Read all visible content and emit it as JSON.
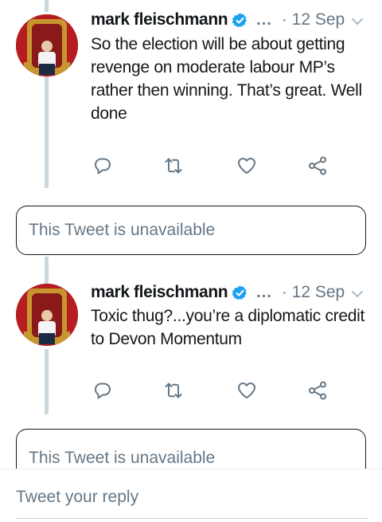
{
  "tweets": [
    {
      "author": "mark fleischmann",
      "more": "...",
      "date": "· 12 Sep",
      "text": "So the election will be about getting revenge on moderate labour MP’s rather then winning. That’s great. Well done"
    },
    {
      "author": "mark fleischmann",
      "more": "...",
      "date": "· 12 Sep",
      "text": "Toxic thug?...you’re a diplomatic credit to Devon Momentum"
    }
  ],
  "unavailable": [
    {
      "label": "This Tweet is unavailable"
    },
    {
      "label": "This Tweet is unavailable"
    }
  ],
  "reply": {
    "placeholder": "Tweet your reply"
  },
  "icons": {
    "verified": "verified-badge-icon",
    "caret": "chevron-down-icon",
    "reply": "reply-icon",
    "retweet": "retweet-icon",
    "like": "heart-icon",
    "share": "share-icon"
  },
  "colors": {
    "text": "#14171a",
    "muted": "#657786",
    "verified": "#1da1f2",
    "thread_line": "#ccd6dd"
  }
}
